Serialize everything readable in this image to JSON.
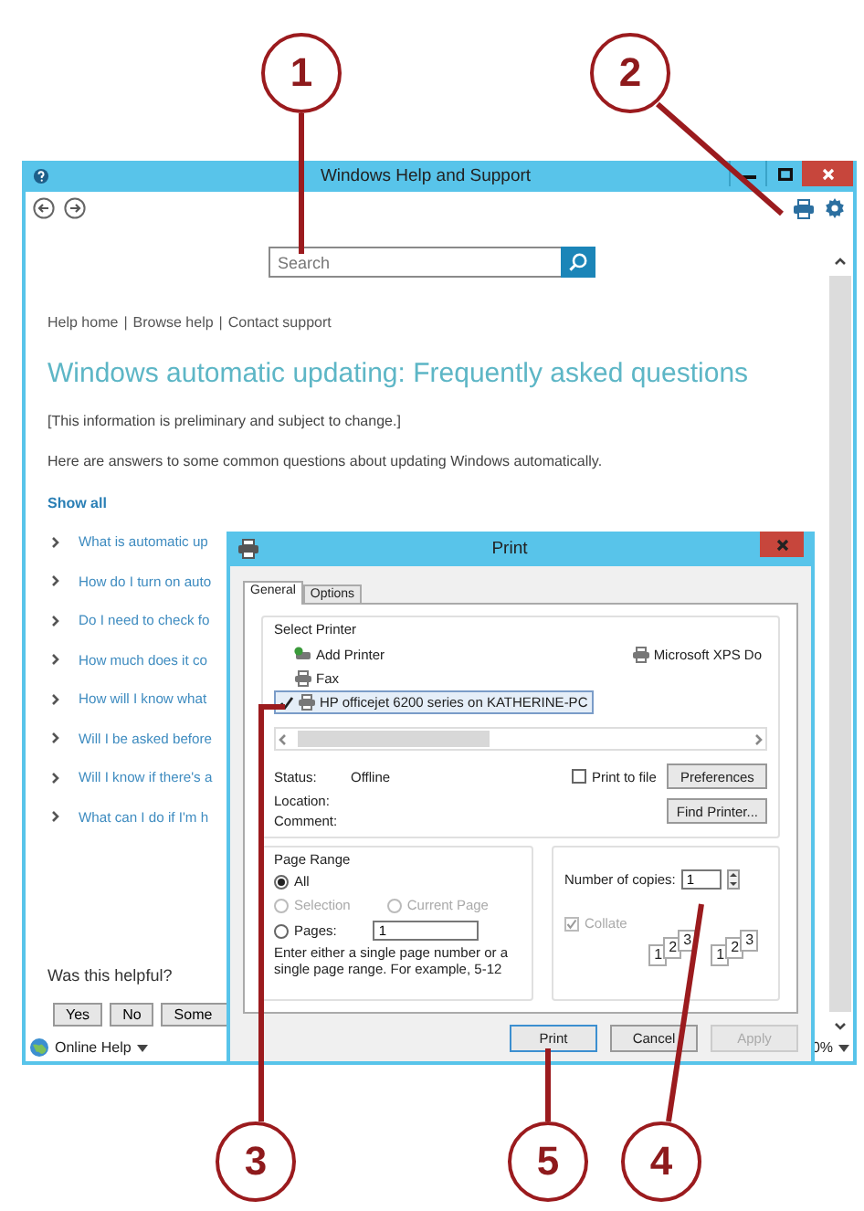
{
  "callouts": [
    {
      "number": "1"
    },
    {
      "number": "2"
    },
    {
      "number": "3"
    },
    {
      "number": "5"
    },
    {
      "number": "4"
    }
  ],
  "help_window": {
    "title": "Windows Help and Support",
    "search": {
      "placeholder": "Search"
    },
    "nav_links": [
      "Help home",
      "Browse help",
      "Contact support"
    ],
    "nav_separator": "|",
    "heading": "Windows automatic updating: Frequently asked questions",
    "paragraphs": [
      "[This information is preliminary and subject to change.]",
      "Here are answers to some common questions about updating Windows automatically."
    ],
    "show_all": "Show all",
    "questions": [
      "What is automatic up",
      "How do I turn on auto",
      "Do I need to check fo",
      "How much does it co",
      "How will I know what",
      "Will I be asked before",
      "Will I know if there's a",
      "What can I do if I'm h"
    ],
    "feedback": {
      "question": "Was this helpful?",
      "buttons": [
        "Yes",
        "No",
        "Some"
      ]
    },
    "footer": {
      "online_help": "Online Help",
      "zoom": "0%"
    }
  },
  "print_dialog": {
    "title": "Print",
    "tabs": [
      {
        "label": "General",
        "selected": true
      },
      {
        "label": "Options",
        "selected": false
      }
    ],
    "select_printer": {
      "label": "Select Printer",
      "printers": [
        {
          "name": "Add Printer",
          "kind": "add",
          "selected": false
        },
        {
          "name": "Fax",
          "kind": "printer",
          "selected": false
        },
        {
          "name": "HP officejet 6200 series on KATHERINE-PC",
          "kind": "printer",
          "selected": true
        },
        {
          "name": "Microsoft XPS Do",
          "kind": "printer",
          "selected": false
        }
      ],
      "info": [
        {
          "label": "Status:",
          "value": "Offline"
        },
        {
          "label": "Location:"
        },
        {
          "label": "Comment:"
        }
      ],
      "print_to_file": {
        "label": "Print to file",
        "checked": false
      },
      "buttons": [
        "Preferences",
        "Find Printer..."
      ]
    },
    "page_range": {
      "label": "Page Range",
      "options": [
        {
          "label": "All",
          "selected": true,
          "disabled": false
        },
        {
          "label": "Selection",
          "selected": false,
          "disabled": true
        },
        {
          "label": "Current Page",
          "selected": false,
          "disabled": true
        },
        {
          "label": "Pages:",
          "selected": false,
          "disabled": false
        }
      ],
      "pages_value": "1",
      "hint": "Enter either a single page number or a single page range.  For example, 5-12"
    },
    "copies": {
      "label": "Number of copies:",
      "value": "1"
    },
    "collate": {
      "label": "Collate",
      "checked": true,
      "disabled": true,
      "pages": [
        [
          "1",
          "2",
          "3"
        ],
        [
          "1",
          "2",
          "3"
        ]
      ]
    },
    "buttons": [
      {
        "label": "Print",
        "disabled": false
      },
      {
        "label": "Cancel",
        "disabled": false
      },
      {
        "label": "Apply",
        "disabled": true
      }
    ]
  }
}
